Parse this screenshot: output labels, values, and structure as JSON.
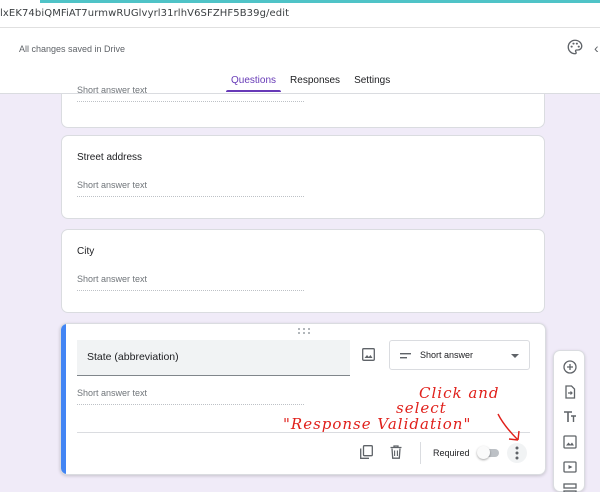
{
  "browser": {
    "url": "lxEK74biQMFiAT7urmwRUGlvyrl31rlhV6SFZHF5B39g/edit"
  },
  "header": {
    "save_status": "All changes saved in Drive",
    "tabs": [
      {
        "label": "Questions",
        "active": true
      },
      {
        "label": "Responses",
        "active": false
      },
      {
        "label": "Settings",
        "active": false
      }
    ]
  },
  "questions": [
    {
      "title": "",
      "placeholder": "Short answer text"
    },
    {
      "title": "Street address",
      "placeholder": "Short answer text"
    },
    {
      "title": "City",
      "placeholder": "Short answer text"
    }
  ],
  "active_question": {
    "title": "State (abbreviation)",
    "type_label": "Short answer",
    "placeholder": "Short answer text",
    "required_label": "Required",
    "required": false
  },
  "annotation": {
    "line1": "Click and",
    "line2": "select",
    "line3": "\"Response Validation\""
  },
  "sidebar_icons": [
    "add-question-icon",
    "import-questions-icon",
    "add-title-icon",
    "add-image-icon",
    "add-video-icon",
    "add-section-icon"
  ],
  "colors": {
    "accent": "#673ab7",
    "background": "#f0ebf8",
    "active_bar": "#4285f4",
    "annotation": "#e0201b"
  }
}
